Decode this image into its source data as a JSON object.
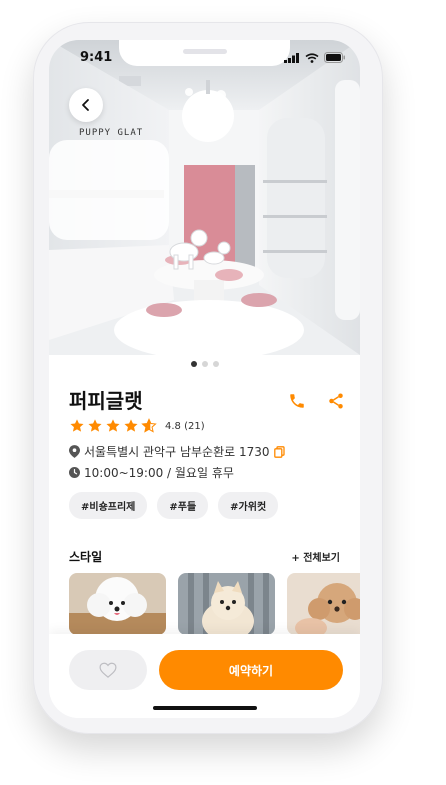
{
  "status_bar": {
    "time": "9:41"
  },
  "hero": {
    "brand_sign": "PUPPY GLAT",
    "photo_count": 3,
    "active_photo": 1
  },
  "shop": {
    "name": "퍼피글랫",
    "rating": 4.8,
    "rating_text": "4.8 (21)",
    "address": "서울특별시 관악구 남부순환로 1730",
    "hours": "10:00~19:00 / 월요일 휴무"
  },
  "tags": [
    "#비숑프리제",
    "#푸들",
    "#가위컷"
  ],
  "styles": {
    "title": "스타일",
    "see_all": "+ 전체보기"
  },
  "bottom": {
    "book_label": "예약하기"
  },
  "colors": {
    "accent": "#ff8a00",
    "star": "#ff8a00",
    "wall_pink": "#d98c97"
  }
}
